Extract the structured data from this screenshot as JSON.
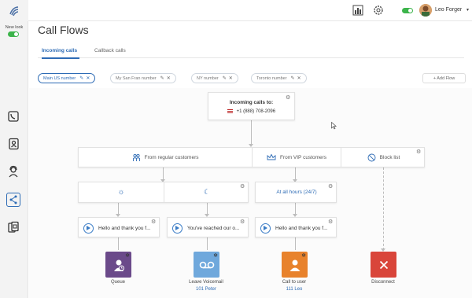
{
  "app": {
    "user_name": "Leo Forger",
    "new_look_label": "New look"
  },
  "page": {
    "title": "Call Flows",
    "tabs": [
      {
        "label": "Incoming calls",
        "active": true
      },
      {
        "label": "Callback calls",
        "active": false
      }
    ]
  },
  "flows": [
    {
      "label": "Main US number",
      "active": true
    },
    {
      "label": "My San Fran number",
      "active": false
    },
    {
      "label": "NY number",
      "active": false
    },
    {
      "label": "Toronto number",
      "active": false
    }
  ],
  "add_flow_label": "+ Add Flow",
  "flow": {
    "incoming": {
      "title": "Incoming calls to:",
      "number": "+1 (888) 708-2096",
      "flag": "us-flag-icon"
    },
    "routing": {
      "regular": "From regular customers",
      "vip": "From VIP customers",
      "block": "Block list"
    },
    "schedule": {
      "day_icon": "sun-icon",
      "night_icon": "moon-icon",
      "all_hours": "At all hours (24/7)"
    },
    "prompts": [
      "Hello and thank you f...",
      "You've reached our o...",
      "Hello and thank you f..."
    ],
    "actions": [
      {
        "label": "Queue",
        "sub": "",
        "color": "#6b4a8a",
        "icon": "queue-icon"
      },
      {
        "label": "Leave Voicemail",
        "sub": "101 Peter",
        "color": "#6fa8dc",
        "icon": "voicemail-icon"
      },
      {
        "label": "Call to user",
        "sub": "111 Leo",
        "color": "#e8822c",
        "icon": "user-icon"
      },
      {
        "label": "Disconnect",
        "sub": "",
        "color": "#d9453a",
        "icon": "close-icon"
      }
    ]
  }
}
